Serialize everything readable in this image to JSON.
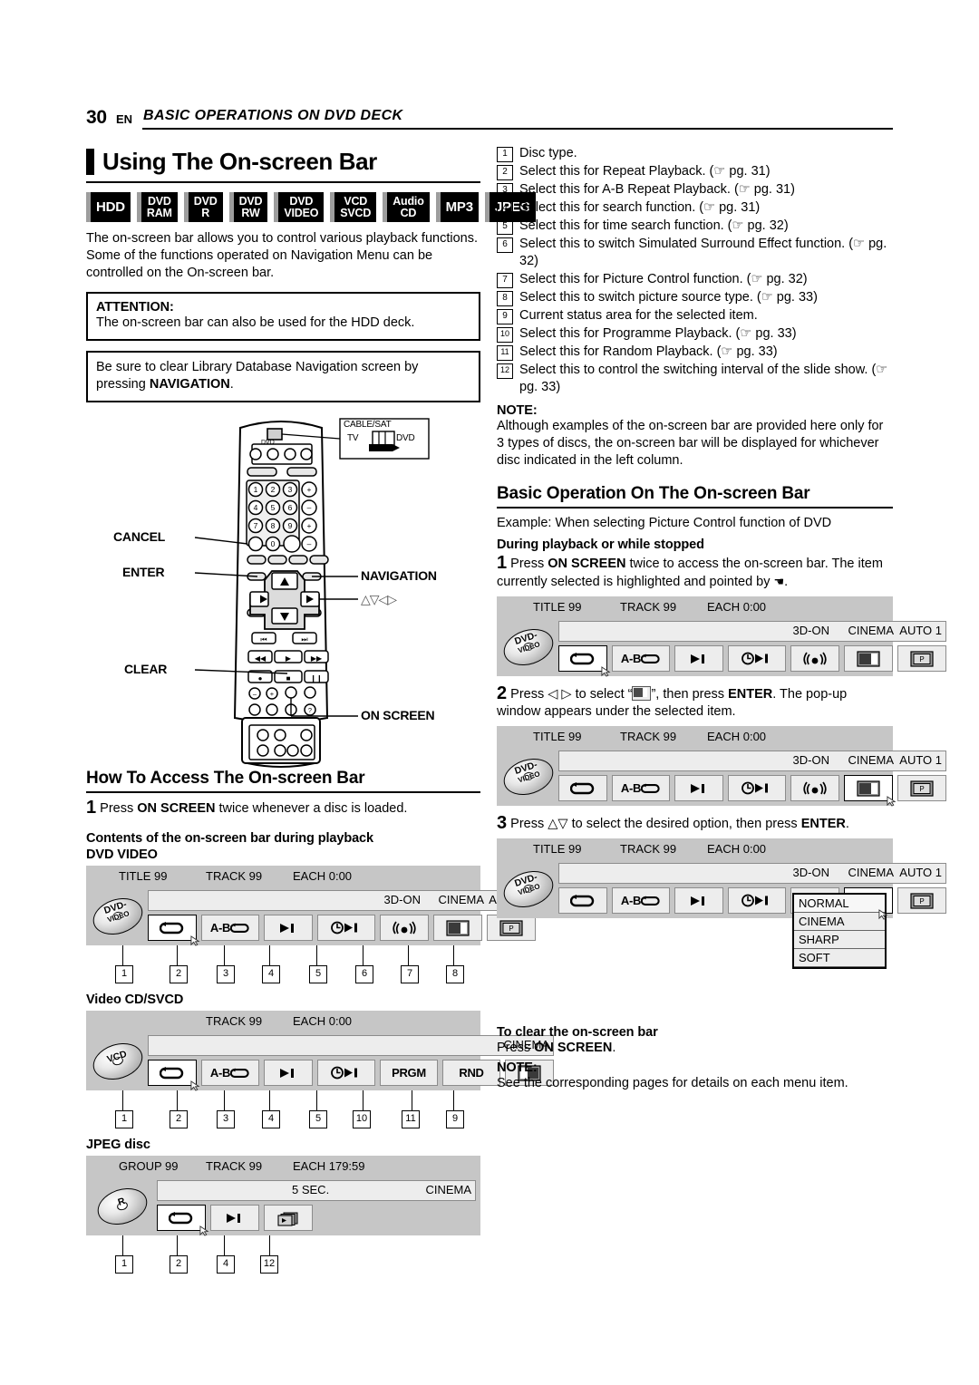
{
  "header": {
    "page_number": "30",
    "lang": "EN",
    "section": "BASIC OPERATIONS ON DVD DECK"
  },
  "left": {
    "title": "Using The On-screen Bar",
    "disc_badges": [
      {
        "lines": [
          "HDD"
        ]
      },
      {
        "lines": [
          "DVD",
          "RAM"
        ]
      },
      {
        "lines": [
          "DVD",
          "R"
        ]
      },
      {
        "lines": [
          "DVD",
          "RW"
        ]
      },
      {
        "lines": [
          "DVD",
          "VIDEO"
        ]
      },
      {
        "lines": [
          "VCD",
          "SVCD"
        ]
      },
      {
        "lines": [
          "Audio",
          "CD"
        ]
      },
      {
        "lines": [
          "MP3"
        ]
      },
      {
        "lines": [
          "JPEG"
        ]
      }
    ],
    "intro": "The on-screen bar allows you to control various playback functions. Some of the functions operated on Navigation Menu can be controlled on the On-screen bar.",
    "attention_label": "ATTENTION:",
    "attention_text": "The on-screen bar can also be used for the HDD deck.",
    "navigation_note_pre": "Be sure to clear Library Database Navigation screen by pressing ",
    "navigation_note_bold": "NAVIGATION",
    "navigation_note_post": ".",
    "remote": {
      "callout_cable_sat": "CABLE/SAT",
      "callout_tv": "TV",
      "callout_dvd": "DVD",
      "label_cancel": "CANCEL",
      "label_enter": "ENTER",
      "label_clear": "CLEAR",
      "label_navigation": "NAVIGATION",
      "label_arrows": "△▽◁▷",
      "label_on_screen": "ON SCREEN"
    },
    "how_to_access_title": "How To Access The On-screen Bar",
    "how_to_step1_num": "1",
    "how_to_step1_pre": "Press ",
    "how_to_step1_bold": "ON SCREEN",
    "how_to_step1_post": " twice whenever a disc is loaded.",
    "contents_heading": "Contents of the on-screen bar during playback",
    "dvd_video_label": "DVD VIDEO",
    "video_cd_label": "Video CD/SVCD",
    "jpeg_label": "JPEG disc"
  },
  "bars": {
    "dvd_video": {
      "disc_label_top": "DVD-",
      "disc_label_bottom": "VIDEO",
      "top_fields": [
        "TITLE 99",
        "TRACK 99",
        "EACH 0:00"
      ],
      "status_fields": [
        "3D-ON",
        "CINEMA",
        "AUTO 1"
      ],
      "icons": [
        "repeat",
        "ab-repeat",
        "search",
        "time-search",
        "surround",
        "picture-control",
        "source-type"
      ],
      "icon_texts": [
        "",
        "A-B",
        "",
        "",
        "",
        "",
        ""
      ],
      "callouts": [
        "1",
        "2",
        "3",
        "4",
        "5",
        "6",
        "7",
        "8"
      ]
    },
    "video_cd": {
      "disc_label_top": "VCD",
      "top_fields": [
        "TRACK 99",
        "EACH 0:00"
      ],
      "status_fields": [
        "CINEMA"
      ],
      "icons": [
        "repeat",
        "ab-repeat",
        "search",
        "time-search",
        "programme",
        "random",
        "source-type"
      ],
      "icon_texts": [
        "",
        "A-B",
        "",
        "",
        "PRGM",
        "RND",
        ""
      ],
      "callouts": [
        "1",
        "2",
        "3",
        "4",
        "5",
        "10",
        "11",
        "9"
      ]
    },
    "jpeg": {
      "disc_label_top": "R",
      "top_fields": [
        "GROUP 99",
        "TRACK 99",
        "EACH 179:59"
      ],
      "status_fields": [
        "5 SEC.",
        "CINEMA"
      ],
      "icons": [
        "repeat",
        "search",
        "slide-show"
      ],
      "callouts": [
        "1",
        "2",
        "4",
        "12"
      ]
    }
  },
  "right": {
    "numbered_items": [
      {
        "n": "1",
        "text": "Disc type."
      },
      {
        "n": "2",
        "text": "Select this for Repeat Playback. (☞ pg. 31)"
      },
      {
        "n": "3",
        "text": "Select this for A-B Repeat Playback. (☞ pg. 31)"
      },
      {
        "n": "4",
        "text": "Select this for search function. (☞ pg. 31)"
      },
      {
        "n": "5",
        "text": "Select this for time search function. (☞ pg. 32)"
      },
      {
        "n": "6",
        "text": "Select this to switch Simulated Surround Effect function. (☞ pg. 32)"
      },
      {
        "n": "7",
        "text": "Select this for Picture Control function. (☞ pg. 32)"
      },
      {
        "n": "8",
        "text": "Select this to switch picture source type. (☞ pg. 33)"
      },
      {
        "n": "9",
        "text": "Current status area for the selected item."
      },
      {
        "n": "10",
        "text": "Select this for Programme Playback. (☞ pg. 33)"
      },
      {
        "n": "11",
        "text": "Select this for Random Playback. (☞ pg. 33)"
      },
      {
        "n": "12",
        "text": "Select this to control the switching interval of the slide show. (☞ pg. 33)"
      }
    ],
    "note1_label": "NOTE:",
    "note1_text": "Although examples of the on-screen bar are provided here only for 3 types of discs, the on-screen bar will be displayed for whichever disc indicated in the left column.",
    "basic_op_title": "Basic Operation On The On-screen Bar",
    "example_line": "Example: When selecting Picture Control function of DVD",
    "during_playback": "During playback or while stopped",
    "step1_num": "1",
    "step1_pre": "Press ",
    "step1_bold": "ON SCREEN",
    "step1_post": " twice to access the on-screen bar. The item currently selected is highlighted and pointed by ",
    "step1_end": ".",
    "step2_num": "2",
    "step2_pre": "Press ◁ ▷ to select “",
    "step2_post": "”, then press ",
    "step2_bold": "ENTER",
    "step2_tail": ". The pop-up window appears under the selected item.",
    "step3_num": "3",
    "step3_pre": "Press △▽ to select the desired option, then press ",
    "step3_bold": "ENTER",
    "step3_post": ".",
    "popup_options": [
      "NORMAL",
      "CINEMA",
      "SHARP",
      "SOFT"
    ],
    "clear_heading": "To clear the on-screen bar",
    "clear_pre": "Press ",
    "clear_bold": "ON SCREEN",
    "clear_post": ".",
    "note2_label": "NOTE:",
    "note2_text": "See the corresponding pages for details on each menu item."
  }
}
